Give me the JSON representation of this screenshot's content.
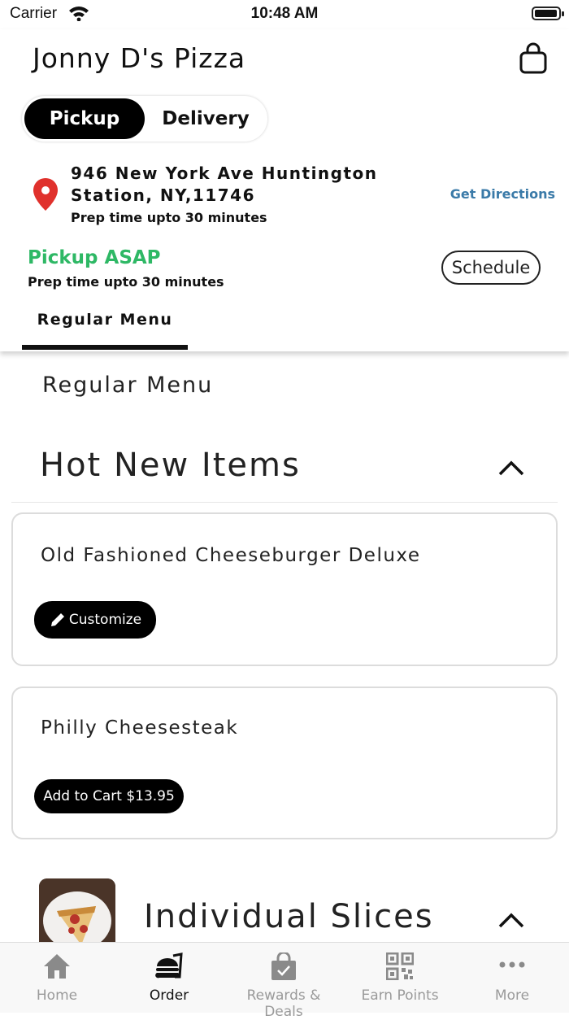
{
  "status_bar": {
    "carrier": "Carrier",
    "time": "10:48 AM",
    "battery_level": 0.95
  },
  "header": {
    "store_name": "Jonny D's Pizza",
    "mode_toggle": {
      "pickup_label": "Pickup",
      "delivery_label": "Delivery",
      "selected": "Pickup"
    },
    "location": {
      "address": "946 New York Ave Huntington Station, NY,11746",
      "prep_time": "Prep time upto 30 minutes",
      "directions_label": "Get Directions"
    },
    "pickup": {
      "asap_label": "Pickup ASAP",
      "prep_time": "Prep time upto 30 minutes",
      "schedule_label": "Schedule"
    },
    "menu_tabs": [
      {
        "label": "Regular Menu",
        "active": true
      }
    ]
  },
  "main": {
    "menu_title": "Regular Menu",
    "categories": [
      {
        "title": "Hot New Items",
        "expanded": true,
        "items": [
          {
            "name": "Old Fashioned Cheeseburger Deluxe",
            "action_label": "Customize"
          },
          {
            "name": "Philly Cheesesteak",
            "action_label": "Add to Cart $13.95"
          }
        ]
      },
      {
        "title": "Individual Slices",
        "expanded": true
      }
    ]
  },
  "tab_bar": {
    "items": [
      {
        "label": "Home",
        "icon": "home-icon",
        "active": false
      },
      {
        "label": "Order",
        "icon": "order-icon",
        "active": true
      },
      {
        "label": "Rewards & Deals",
        "icon": "rewards-bag-icon",
        "active": false
      },
      {
        "label": "Earn Points",
        "icon": "qr-code-icon",
        "active": false
      },
      {
        "label": "More",
        "icon": "more-dots-icon",
        "active": false
      }
    ]
  },
  "colors": {
    "accent_green": "#2eb865",
    "link_blue": "#3a7aa8",
    "pin_red": "#e0312c",
    "inactive_gray": "#9a9a9a"
  }
}
